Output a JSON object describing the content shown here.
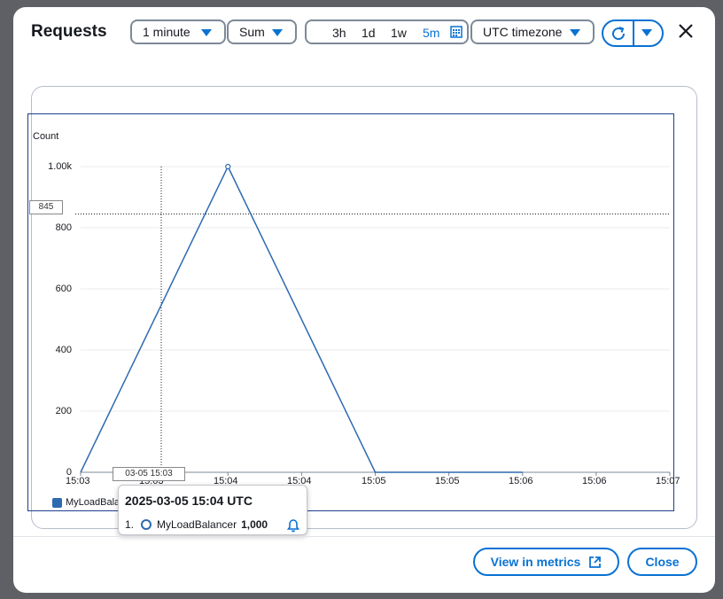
{
  "dialog": {
    "title": "Requests",
    "period": "1 minute",
    "statistic": "Sum",
    "ranges": [
      "3h",
      "1d",
      "1w",
      "5m"
    ],
    "active_range": "5m",
    "timezone": "UTC timezone"
  },
  "chart_data": {
    "type": "line",
    "ylabel": "Count",
    "ytick_labels": [
      "0",
      "200",
      "400",
      "600",
      "800",
      "1.00k"
    ],
    "xtick_labels": [
      "15:03",
      "15:03",
      "15:04",
      "15:04",
      "15:05",
      "15:05",
      "15:06",
      "15:06",
      "15:07"
    ],
    "ylim": [
      0,
      1000
    ],
    "series": [
      {
        "name": "MyLoadBalancer",
        "x": [
          "15:03",
          "15:04",
          "15:05",
          "15:06"
        ],
        "values": [
          0,
          1000,
          0,
          0
        ]
      }
    ],
    "crosshair_y_label": "845",
    "crosshair_x_label": "03-05 15:03",
    "grid": true
  },
  "tooltip": {
    "title": "2025-03-05 15:04 UTC",
    "index": "1.",
    "series_name": "MyLoadBalancer",
    "value": "1,000"
  },
  "colors": {
    "accent": "#0972d3",
    "series": "#2d6ab0",
    "frame": "#1c3f8e"
  },
  "footer": {
    "view_metrics": "View in metrics",
    "close": "Close"
  }
}
